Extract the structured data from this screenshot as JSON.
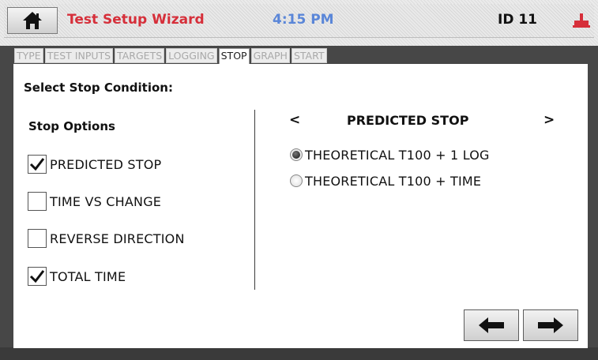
{
  "header": {
    "title": "Test Setup Wizard",
    "time": "4:15 PM",
    "device_id": "ID 11",
    "home_icon": "home-icon",
    "status_icon": "connection-icon",
    "colors": {
      "title": "#d62f3a",
      "time": "#5a86d8"
    }
  },
  "tabs": [
    {
      "label": "TYPE",
      "active": false
    },
    {
      "label": "TEST INPUTS",
      "active": false
    },
    {
      "label": "TARGETS",
      "active": false
    },
    {
      "label": "LOGGING",
      "active": false
    },
    {
      "label": "STOP",
      "active": true
    },
    {
      "label": "GRAPH",
      "active": false
    },
    {
      "label": "START",
      "active": false
    }
  ],
  "panel": {
    "section_title": "Select Stop Condition:",
    "options_title": "Stop Options",
    "options": [
      {
        "label": "PREDICTED STOP",
        "checked": true
      },
      {
        "label": "TIME VS CHANGE",
        "checked": false
      },
      {
        "label": "REVERSE DIRECTION",
        "checked": false
      },
      {
        "label": "TOTAL TIME",
        "checked": true
      }
    ],
    "nav_prev": "<",
    "nav_next": ">",
    "mode_title": "PREDICTED STOP",
    "radios": [
      {
        "label": "THEORETICAL T100 + 1 LOG",
        "selected": true
      },
      {
        "label": "THEORETICAL T100 + TIME",
        "selected": false
      }
    ]
  },
  "footer": {
    "back_icon": "arrow-left-icon",
    "next_icon": "arrow-right-icon"
  }
}
